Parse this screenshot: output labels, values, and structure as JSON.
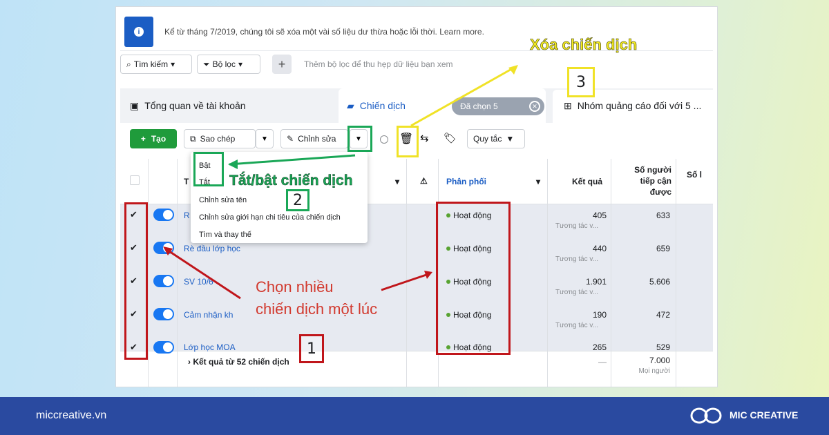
{
  "notice": {
    "text": "Kể từ tháng 7/2019, chúng tôi sẽ xóa một vài số liệu dư thừa hoặc lỗi thời. Learn more."
  },
  "filters": {
    "search": "Tìm kiếm",
    "filter": "Bộ lọc",
    "placeholder": "Thêm bộ lọc để thu hẹp dữ liệu bạn xem"
  },
  "tabs": {
    "overview": "Tổng quan về tài khoản",
    "campaigns": "Chiến dịch",
    "selected": "Đã chọn 5",
    "adsets": "Nhóm quảng cáo đối với 5 ..."
  },
  "toolbar": {
    "create": "Tạo",
    "copy": "Sao chép",
    "edit": "Chỉnh sửa",
    "rules": "Quy tắc"
  },
  "menu": {
    "items": [
      "Bật",
      "Tắt",
      "Chỉnh sửa tên",
      "Chỉnh sửa giới hạn chi tiêu của chiến dịch",
      "Tìm và thay thế"
    ]
  },
  "table": {
    "headers": {
      "name": "T",
      "delivery": "Phân phối",
      "results": "Kết quả",
      "reach": "Số người tiếp cận được",
      "more": "Số l"
    },
    "rows": [
      {
        "name": "R",
        "delivery": "Hoạt động",
        "result": "405",
        "result_type": "Tương tác v...",
        "reach": "633"
      },
      {
        "name": "Rè đầu lớp học",
        "delivery": "Hoạt động",
        "result": "440",
        "result_type": "Tương tác v...",
        "reach": "659"
      },
      {
        "name": "SV 10/6",
        "delivery": "Hoạt động",
        "result": "1.901",
        "result_type": "Tương tác v...",
        "reach": "5.606"
      },
      {
        "name": "Cảm nhận kh",
        "delivery": "Hoạt động",
        "result": "190",
        "result_type": "Tương tác v...",
        "reach": "472"
      },
      {
        "name": "Lớp học MOA",
        "delivery": "Hoạt động",
        "result": "265",
        "result_type": "",
        "reach": "529"
      }
    ],
    "footer": {
      "label": "Kết quả từ 52 chiến dịch",
      "result": "—",
      "reach": "7.000",
      "reach_sub": "Mọi người"
    }
  },
  "annotations": {
    "delete": "Xóa chiến dịch",
    "toggle": "Tắt/bật chiến dịch",
    "multi_line1": "Chọn nhiều",
    "multi_line2": "chiến dịch một lúc",
    "n1": "1",
    "n2": "2",
    "n3": "3"
  },
  "footer_bar": {
    "site": "miccreative.vn",
    "brand": "MIC CREATIVE"
  }
}
